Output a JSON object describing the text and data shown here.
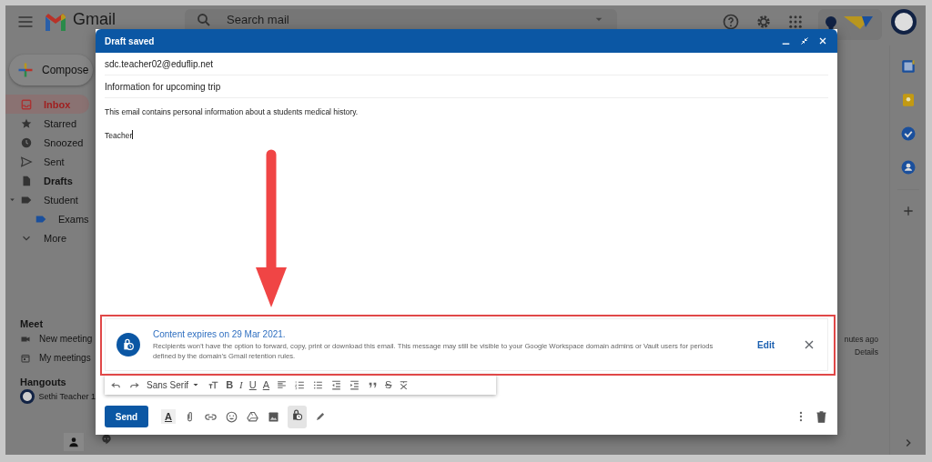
{
  "header": {
    "app_name": "Gmail",
    "search": {
      "placeholder": "Search mail"
    }
  },
  "sidebar": {
    "compose": "Compose",
    "items": [
      {
        "label": "Inbox",
        "selected": true,
        "unread": true
      },
      {
        "label": "Starred",
        "selected": false,
        "unread": false
      },
      {
        "label": "Snoozed",
        "selected": false,
        "unread": false
      },
      {
        "label": "Sent",
        "selected": false,
        "unread": false
      },
      {
        "label": "Drafts",
        "selected": false,
        "unread": true
      },
      {
        "label": "Student",
        "selected": false,
        "unread": false,
        "expanded": true,
        "children": [
          {
            "label": "Exams",
            "selected": false,
            "unread": false
          }
        ]
      },
      {
        "label": "More",
        "selected": false,
        "unread": false
      }
    ],
    "meet": {
      "heading": "Meet",
      "items": [
        "New meeting",
        "My meetings"
      ]
    },
    "hangouts": {
      "heading": "Hangouts",
      "contact": "Sethi Teacher 1"
    }
  },
  "background_mail": {
    "time": "nutes ago",
    "details": "Details"
  },
  "compose": {
    "title": "Draft saved",
    "to": "sdc.teacher02@eduflip.net",
    "subject": "Information for upcoming trip",
    "body": [
      "This email contains personal information about a students medical history.",
      "Teacher"
    ],
    "confidential_notice": {
      "title": "Content expires on 29 Mar 2021.",
      "description": "Recipients won't have the option to forward, copy, print or download this email. This message may still be visible to your Google Workspace domain admins or Vault users for periods defined by the domain's Gmail retention rules.",
      "action": "Edit"
    },
    "format_toolbar": {
      "font": "Sans Serif",
      "style_buttons": [
        "B",
        "I",
        "U",
        "A"
      ],
      "strike": "S"
    },
    "send": "Send",
    "formatting_toggle": "A",
    "confidential_mode_on": true
  }
}
